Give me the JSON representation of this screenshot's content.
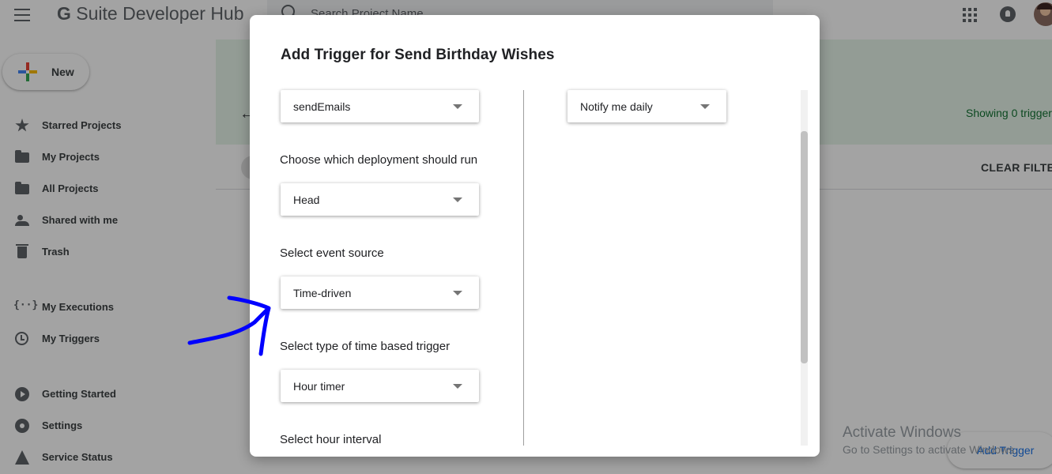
{
  "app": {
    "title_g": "G",
    "title_rest": "Suite Developer Hub",
    "search_placeholder": "Search Project Name"
  },
  "new_button": {
    "label": "New"
  },
  "sidebar": {
    "items": [
      {
        "label": "Starred Projects",
        "icon": "star-icon"
      },
      {
        "label": "My Projects",
        "icon": "folder-icon"
      },
      {
        "label": "All Projects",
        "icon": "folder-icon"
      },
      {
        "label": "Shared with me",
        "icon": "people-icon"
      },
      {
        "label": "Trash",
        "icon": "trash-icon"
      },
      {
        "label": "My Executions",
        "icon": "executions-icon"
      },
      {
        "label": "My Triggers",
        "icon": "alarm-icon"
      },
      {
        "label": "Getting Started",
        "icon": "play-circle-icon"
      },
      {
        "label": "Settings",
        "icon": "gear-icon"
      },
      {
        "label": "Service Status",
        "icon": "warning-icon"
      }
    ]
  },
  "main": {
    "showing_text": "Showing 0 trigger",
    "clear_filters_label": "CLEAR FILTER",
    "add_trigger_label": "Add Trigger"
  },
  "watermark": {
    "title": "Activate Windows",
    "subtitle": "Go to Settings to activate Windows."
  },
  "dialog": {
    "title": "Add Trigger for Send Birthday Wishes",
    "function_value": "sendEmails",
    "deployment_label": "Choose which deployment should run",
    "deployment_value": "Head",
    "event_source_label": "Select event source",
    "event_source_value": "Time-driven",
    "time_trigger_label": "Select type of time based trigger",
    "time_trigger_value": "Hour timer",
    "hour_interval_label": "Select hour interval",
    "notify_value": "Notify me daily"
  },
  "colors": {
    "accent_blue": "#1a73e8",
    "annotation_blue": "#0000ff",
    "success_green": "#137333"
  }
}
